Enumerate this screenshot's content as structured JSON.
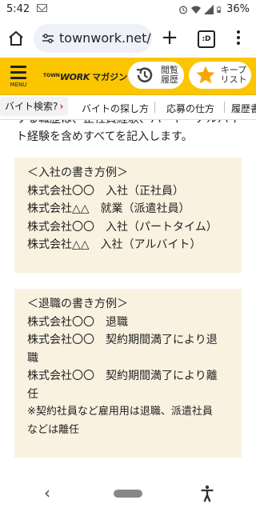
{
  "status_bar": {
    "time": "5:42",
    "battery": "36%",
    "icons": [
      "mail-icon",
      "alarm-icon",
      "wifi-icon",
      "signal-icon",
      "battery-icon"
    ]
  },
  "browser": {
    "url": "townwork.net/r",
    "tab_count": ":D",
    "icons": [
      "home-icon",
      "site-settings-icon",
      "new-tab-plus-icon",
      "tab-switcher-icon",
      "more-menu-icon"
    ]
  },
  "site_header": {
    "menu_label": "MENU",
    "logo_town": "TOWN",
    "logo_work": "WORK",
    "logo_magazine": "マガジン",
    "history_label_1": "閲覧",
    "history_label_2": "履歴",
    "keep_label_1": "キープ",
    "keep_label_2": "リスト",
    "accent_color": "#fbc500",
    "keep_star_color": "#f7a600"
  },
  "category_tabs": [
    {
      "label": "バイト検索?",
      "active": true
    },
    {
      "label": "バイトの探し方"
    },
    {
      "label": "応募の仕方"
    },
    {
      "label": "履歴書"
    }
  ],
  "content": {
    "intro_line_1": "する職歴は、正社員経験、パート・アルバイ",
    "intro_line_2": "ト経験を含めすべてを記入します。",
    "join_box": {
      "title": "＜入社の書き方例＞",
      "rows": [
        {
          "company": "株式会社〇〇",
          "action": "入社（正社員）"
        },
        {
          "company": "株式会社△△",
          "action": "就業（派遣社員）"
        },
        {
          "company": "株式会社〇〇",
          "action": "入社（パートタイム）"
        },
        {
          "company": "株式会社△△",
          "action": "入社（アルバイト）"
        }
      ]
    },
    "leave_box": {
      "title": "＜退職の書き方例＞",
      "row1_company": "株式会社〇〇",
      "row1_action": "退職",
      "row2_company": "株式会社〇〇",
      "row2_action": "契約期間満了により退",
      "row2_wrap": "職",
      "row3_company": "株式会社〇〇",
      "row3_action": "契約期間満了により離",
      "row3_wrap": "任",
      "note_1": "※契約社員など雇用用は退職、派遣社員",
      "note_2": "などは離任"
    },
    "box_bg_color": "#faf2e1"
  },
  "nav_bar": {
    "back_glyph": "‹",
    "icons": [
      "back-icon",
      "home-pill-icon",
      "accessibility-icon"
    ]
  }
}
